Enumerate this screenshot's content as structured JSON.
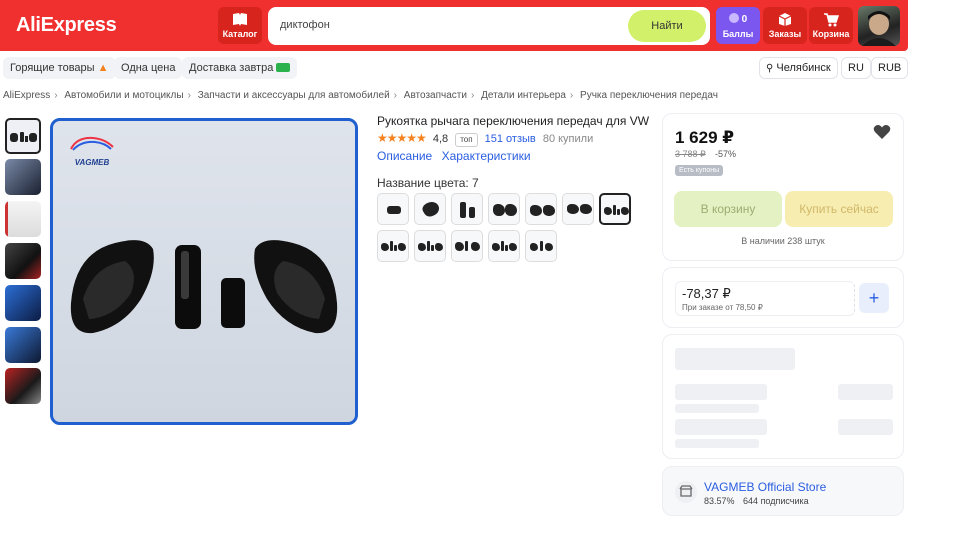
{
  "header": {
    "logo": "AliExpress",
    "catalog_label": "Каталог",
    "search_value": "диктофон",
    "search_button": "Найти",
    "points_count": "0",
    "points_label": "Баллы",
    "orders_label": "Заказы",
    "cart_label": "Корзина"
  },
  "chips": {
    "hot": "Горящие товары",
    "one_price": "Одна цена",
    "delivery": "Доставка завтра",
    "city": "Челябинск",
    "lang": "RU",
    "currency": "RUB"
  },
  "breadcrumb": [
    "AliExpress",
    "Автомобили и мотоциклы",
    "Запчасти и аксессуары для автомобилей",
    "Автозапчасти",
    "Детали интерьера",
    "Ручка переключения передач"
  ],
  "product": {
    "brand_watermark": "VAGMEB",
    "title": "Рукоятка рычага переключения передач для VW",
    "stars": "★★★★★",
    "rating": "4,8",
    "top_badge": "топ",
    "reviews": "151 отзыв",
    "sold": "80 купили",
    "tab_description": "Описание",
    "tab_specs": "Характеристики",
    "color_label": "Название цвета: 7"
  },
  "buy_box": {
    "price": "1 629 ₽",
    "old_price": "3 788 ₽",
    "discount": "-57%",
    "coupon": "Есть купоны",
    "add_to_cart": "В корзину",
    "buy_now": "Купить сейчас",
    "stock": "В наличии 238 штук"
  },
  "installment": {
    "price": "-78,37 ₽",
    "sub": "При заказе от 78,50 ₽",
    "plus": "+"
  },
  "store": {
    "name": "VAGMEB Official Store",
    "positive": "83.57%",
    "subscribers": "644 подписчика"
  },
  "colors": {
    "brand_red": "#f02f2f",
    "accent_green": "#d2f06a",
    "link_blue": "#2a5de0",
    "points_purple": "#7b57f0",
    "star_orange": "#f5821f"
  }
}
